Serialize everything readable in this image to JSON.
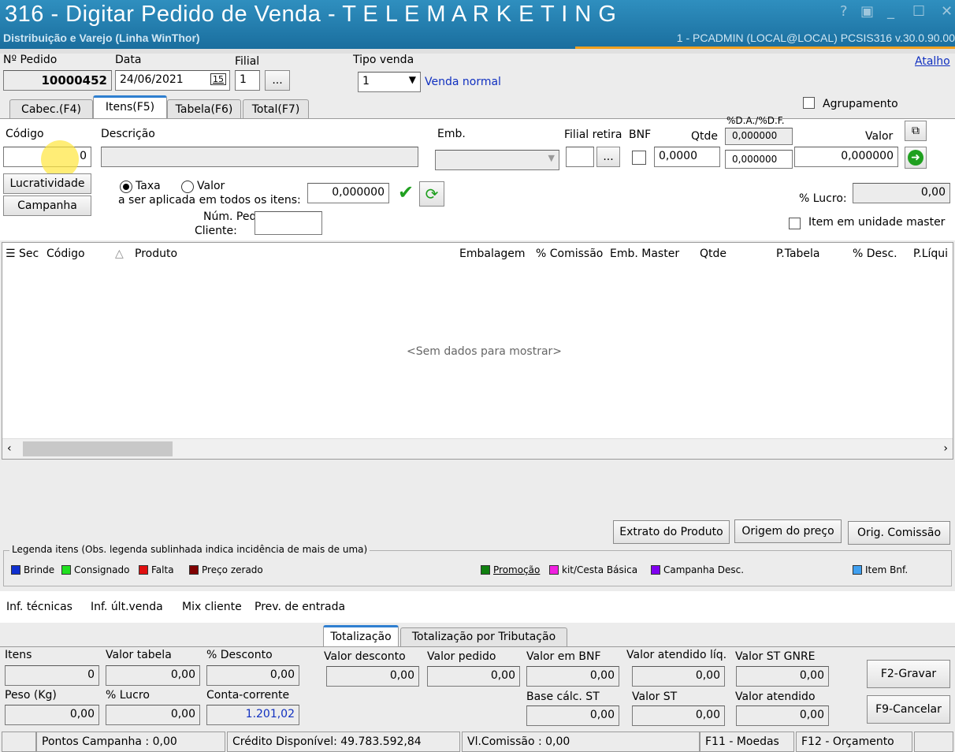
{
  "window": {
    "title": "316 - Digitar Pedido de Venda - T E L E M A R K E T I N G",
    "subtitle": "Distribuição e Varejo (Linha WinThor)",
    "session": "1 - PCADMIN (LOCAL@LOCAL)   PCSIS316  v.30.0.90.00",
    "controls": [
      "?",
      "▣",
      "_",
      "☐",
      "✕"
    ]
  },
  "header": {
    "pedido_label": "Nº Pedido",
    "pedido_value": "10000452",
    "data_label": "Data",
    "data_value": "24/06/2021",
    "calendar_glyph": "15",
    "filial_label": "Filial",
    "filial_value": "1",
    "ellipsis": "...",
    "tipo_venda_label": "Tipo venda",
    "tipo_venda_value": "1",
    "tipo_venda_desc": "Venda normal",
    "atalho": "Atalho"
  },
  "tabs": [
    {
      "label": "Cabec.(F4)"
    },
    {
      "label": "Itens(F5)"
    },
    {
      "label": "Tabela(F6)"
    },
    {
      "label": "Total(F7)"
    }
  ],
  "item_form": {
    "agrupamento": "Agrupamento",
    "codigo_label": "Código",
    "codigo_value": "0",
    "descricao_label": "Descrição",
    "emb_label": "Emb.",
    "filial_retira_label": "Filial retira",
    "bnf_label": "BNF",
    "qtde_label": "Qtde",
    "qtde_value": "0,0000",
    "da_df_label": "%D.A./%D.F.",
    "da_value": "0,000000",
    "df_value": "0,000000",
    "valor_label": "Valor",
    "valor_value": "0,000000",
    "lucratividade": "Lucratividade",
    "campanha": "Campanha",
    "taxa": "Taxa",
    "valor_radio": "Valor",
    "aplicada_label": "a ser aplicada em todos os itens:",
    "aplicada_value": "0,000000",
    "num_ped_label": "Núm. Ped.",
    "cliente_label": "Cliente:",
    "lucro_label": "% Lucro:",
    "lucro_value": "0,00",
    "unidade_master": "Item em unidade master"
  },
  "grid": {
    "columns": [
      "Sec",
      "Código",
      "Produto",
      "Embalagem",
      "% Comissão",
      "Emb. Master",
      "Qtde",
      "P.Tabela",
      "% Desc.",
      "P.Líqui"
    ],
    "empty": "<Sem dados para mostrar>"
  },
  "actions": {
    "extrato": "Extrato do Produto",
    "origem": "Origem do preço",
    "orig_comissao": "Orig. Comissão"
  },
  "legend": {
    "title": "Legenda itens (Obs. legenda sublinhada indica incidência de mais de uma)",
    "items": [
      {
        "label": "Brinde",
        "color": "#1030d0"
      },
      {
        "label": "Consignado",
        "color": "#20e020"
      },
      {
        "label": "Falta",
        "color": "#e01010"
      },
      {
        "label": "Preço zerado",
        "color": "#800000"
      },
      {
        "label": "Promoção",
        "color": "#108010"
      },
      {
        "label": "kit/Cesta Básica",
        "color": "#f020e0"
      },
      {
        "label": "Campanha Desc.",
        "color": "#8000f0"
      },
      {
        "label": "Item Bnf.",
        "color": "#40a0f0"
      }
    ]
  },
  "info_links": [
    "Inf. técnicas",
    "Inf. últ.venda",
    "Mix cliente",
    "Prev. de entrada"
  ],
  "totals_tabs": [
    "Totalização",
    "Totalização por Tributação"
  ],
  "totals": {
    "itens_label": "Itens",
    "itens_value": "0",
    "valor_tabela_label": "Valor tabela",
    "valor_tabela_value": "0,00",
    "desconto_label": "% Desconto",
    "desconto_value": "0,00",
    "valor_desconto_label": "Valor desconto",
    "valor_desconto_value": "0,00",
    "valor_pedido_label": "Valor pedido",
    "valor_pedido_value": "0,00",
    "valor_bnf_label": "Valor em BNF",
    "valor_bnf_value": "0,00",
    "valor_atendido_liq_label": "Valor atendido líq.",
    "valor_atendido_liq_value": "0,00",
    "valor_st_gnre_label": "Valor ST GNRE",
    "valor_st_gnre_value": "0,00",
    "peso_label": "Peso (Kg)",
    "peso_value": "0,00",
    "lucro_label": "% Lucro",
    "lucro_value": "0,00",
    "conta_corrente_label": "Conta-corrente",
    "conta_corrente_value": "1.201,02",
    "base_st_label": "Base cálc. ST",
    "base_st_value": "0,00",
    "valor_st_label": "Valor ST",
    "valor_st_value": "0,00",
    "valor_atendido_label": "Valor atendido",
    "valor_atendido_value": "0,00",
    "gravar": "F2-Gravar",
    "cancelar": "F9-Cancelar"
  },
  "status": {
    "pontos": "Pontos Campanha : 0,00",
    "credito": "Crédito Disponível: 49.783.592,84",
    "comissao": "Vl.Comissão : 0,00",
    "moedas": "F11 - Moedas",
    "orcamento": "F12 - Orçamento"
  }
}
